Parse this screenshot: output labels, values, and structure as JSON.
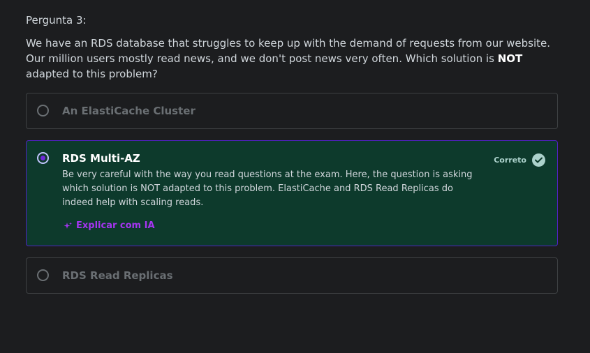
{
  "question": {
    "label": "Pergunta 3:",
    "text_before": "We have an RDS database that struggles to keep up with the demand of requests from our website. Our million users mostly read news, and we don't post news very often. Which solution is ",
    "text_emphasis": "NOT",
    "text_after": " adapted to this problem?"
  },
  "options": [
    {
      "label": "An ElastiCache Cluster",
      "selected": false
    },
    {
      "label": "RDS Multi-AZ",
      "selected": true,
      "status": "Correto",
      "explanation": "Be very careful with the way you read questions at the exam. Here, the question is asking which solution is NOT adapted to this problem. ElastiCache and RDS Read Replicas do indeed help with scaling reads.",
      "explain_link": "Explicar com IA"
    },
    {
      "label": "RDS Read Replicas",
      "selected": false
    }
  ],
  "colors": {
    "background": "#1c1d1f",
    "correct_bg": "#0d3a2c",
    "selected_border": "#5022c3",
    "accent_purple": "#a435f0",
    "correct_green": "#acd2cc"
  },
  "icons": {
    "correct": "check-circle-icon",
    "ai": "sparkle-icon"
  }
}
